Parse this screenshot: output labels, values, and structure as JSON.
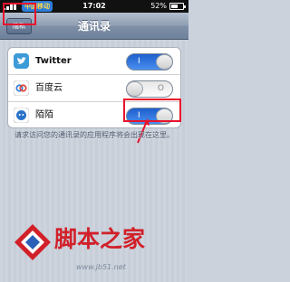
{
  "status_bar": {
    "carrier": "中国移动",
    "time": "17:02",
    "battery": "52%"
  },
  "nav": {
    "back_label": "隐私",
    "title": "通讯录"
  },
  "apps": [
    {
      "label": "Twitter",
      "toggle_on": true,
      "toggle_text": "I",
      "icon": "twitter-bird-icon",
      "color": "#3d9bd8"
    },
    {
      "label": "百度云",
      "toggle_on": false,
      "toggle_text": "O",
      "icon": "baidu-cloud-icon",
      "color": "#4d8ad4"
    },
    {
      "label": "陌陌",
      "toggle_on": true,
      "toggle_text": "I",
      "icon": "momo-icon",
      "color": "#2b72c9"
    }
  ],
  "note": "请求访问您的通讯录的应用程序将会出现在这里。",
  "watermark": {
    "title": "脚本之家",
    "url": "www.jb51.net"
  },
  "colors": {
    "highlight": "#e8132c",
    "toggle_on": "#2a6fdc"
  }
}
